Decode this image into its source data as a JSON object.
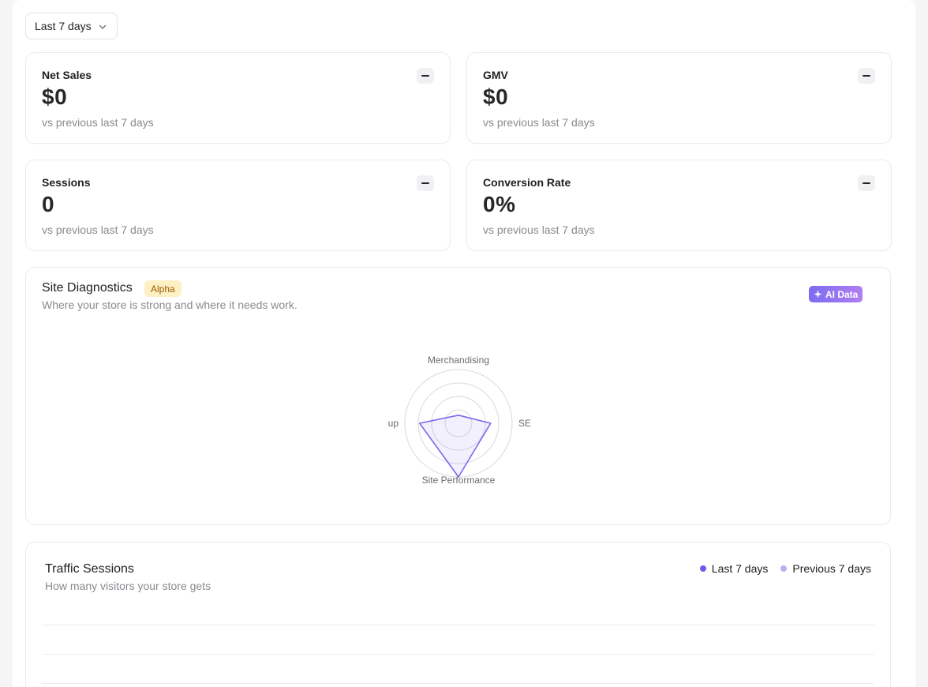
{
  "filter": {
    "period": "Last 7 days"
  },
  "metrics": [
    {
      "title": "Net Sales",
      "value": "$0",
      "comparison": "vs previous last 7 days",
      "trend_icon": "minus-icon"
    },
    {
      "title": "GMV",
      "value": "$0",
      "comparison": "vs previous last 7 days",
      "trend_icon": "minus-icon"
    },
    {
      "title": "Sessions",
      "value": "0",
      "comparison": "vs previous last 7 days",
      "trend_icon": "minus-icon"
    },
    {
      "title": "Conversion Rate",
      "value": "0%",
      "comparison": "vs previous last 7 days",
      "trend_icon": "minus-icon"
    }
  ],
  "diagnostics": {
    "title": "Site Diagnostics",
    "badge": "Alpha",
    "subtitle": "Where your store is strong and where it needs work.",
    "ai_badge": "AI Data",
    "ai_icon": "sparkle-icon"
  },
  "chart_data": {
    "type": "radar",
    "axes": [
      "Merchandising",
      "SE",
      "Site Performance",
      "up"
    ],
    "rings": 4,
    "max": 4,
    "series": [
      {
        "values": [
          0.6,
          2.4,
          4.0,
          2.9
        ],
        "color": "#7b68ee"
      }
    ]
  },
  "traffic": {
    "title": "Traffic Sessions",
    "subtitle": "How many visitors your store gets",
    "legend": [
      {
        "label": "Last 7 days",
        "color": "#6b5ce7"
      },
      {
        "label": "Previous 7 days",
        "color": "#b8b0f5"
      }
    ]
  },
  "colors": {
    "accent": "#7b68ee",
    "badge_bg": "#fdf0c4",
    "badge_text": "#9a5b00"
  }
}
